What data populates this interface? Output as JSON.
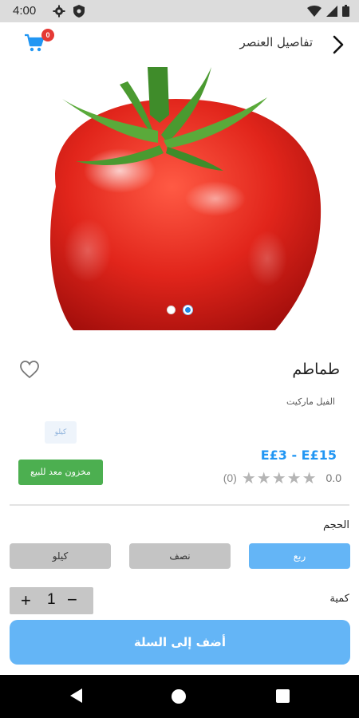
{
  "status_bar": {
    "time": "4:00",
    "icons": [
      "gear-icon",
      "shield-icon",
      "wifi-icon",
      "signal-icon",
      "battery-icon"
    ]
  },
  "header": {
    "title": "تفاصيل العنصر",
    "cart_count": "0",
    "icons": [
      "cart-icon",
      "chevron-right-icon"
    ]
  },
  "product": {
    "image": "tomato",
    "name": "طماطم",
    "store": "الفيل ماركيت",
    "unit_chip": "كيلو",
    "price": "E£3  - E£15",
    "stock_label": "مخزون معد للبيع",
    "rating_value": "0.0",
    "rating_stars": 0,
    "rating_count": "(0)",
    "carousel": {
      "count": 2,
      "active_index": 1
    }
  },
  "size": {
    "label": "الحجم",
    "options": [
      {
        "label": "ربع",
        "selected": true
      },
      {
        "label": "نصف",
        "selected": false
      },
      {
        "label": "كيلو",
        "selected": false
      }
    ]
  },
  "quantity": {
    "label": "كمية",
    "value": "1",
    "plus": "+",
    "minus": "−"
  },
  "actions": {
    "add_to_cart": "أضف إلى السلة"
  },
  "colors": {
    "accent": "#2196f3",
    "button": "#64b5f6",
    "stock": "#4caf50",
    "badge": "#e53935"
  }
}
